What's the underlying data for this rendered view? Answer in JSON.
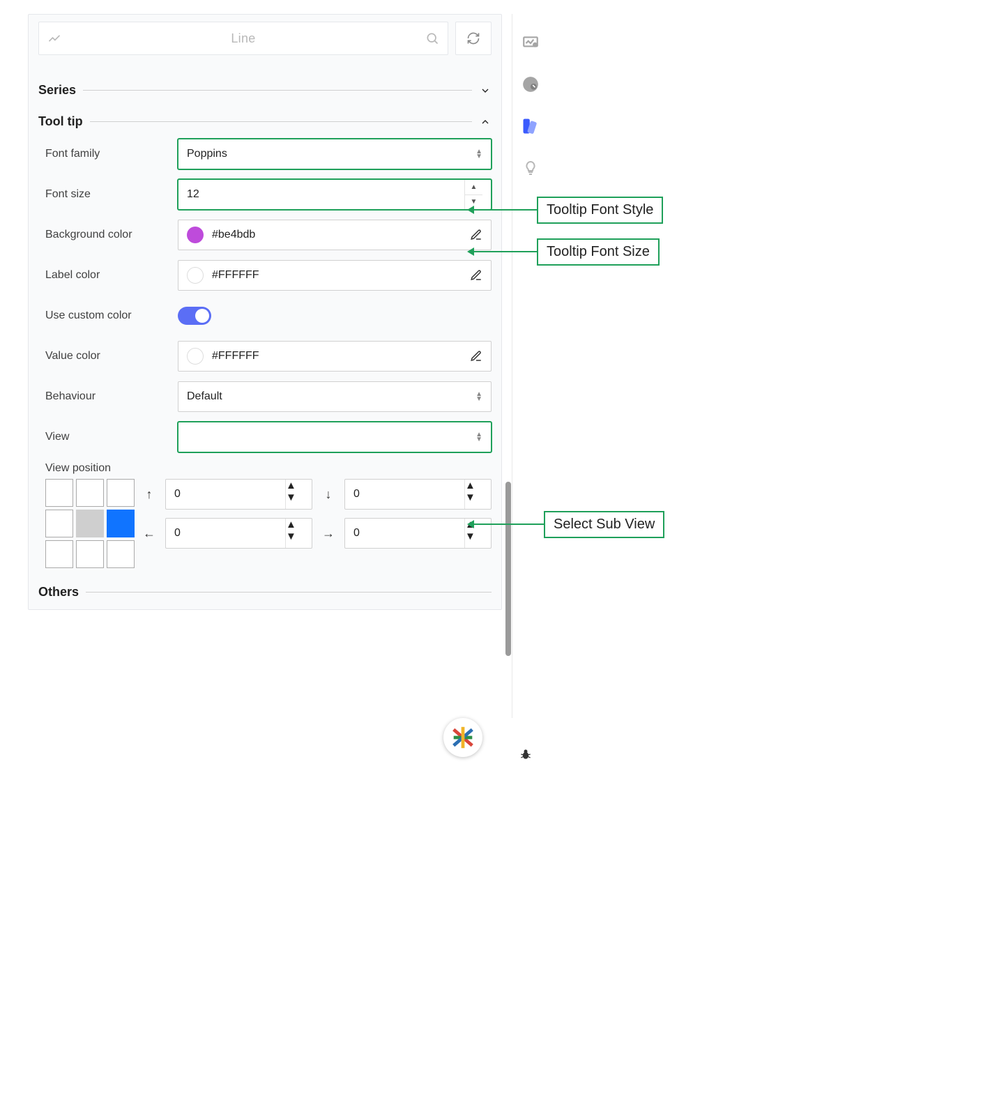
{
  "header": {
    "search_text": "Line"
  },
  "sections": {
    "series": {
      "title": "Series"
    },
    "tooltip": {
      "title": "Tool tip",
      "font_family": {
        "label": "Font family",
        "value": "Poppins"
      },
      "font_size": {
        "label": "Font size",
        "value": "12"
      },
      "bg_color": {
        "label": "Background color",
        "value": "#be4bdb",
        "swatch": "#be4bdb"
      },
      "label_color": {
        "label": "Label color",
        "value": "#FFFFFF",
        "swatch": "#FFFFFF"
      },
      "use_custom": {
        "label": "Use custom color"
      },
      "value_color": {
        "label": "Value color",
        "value": "#FFFFFF",
        "swatch": "#FFFFFF"
      },
      "behaviour": {
        "label": "Behaviour",
        "value": "Default"
      },
      "view": {
        "label": "View",
        "value": ""
      },
      "view_position": {
        "label": "View position"
      },
      "nudge": {
        "up": "0",
        "down": "0",
        "left": "0",
        "right": "0"
      }
    },
    "others": {
      "title": "Others"
    }
  },
  "annotations": {
    "font_style": "Tooltip Font Style",
    "font_size": "Tooltip Font Size",
    "sub_view": "Select Sub View"
  }
}
